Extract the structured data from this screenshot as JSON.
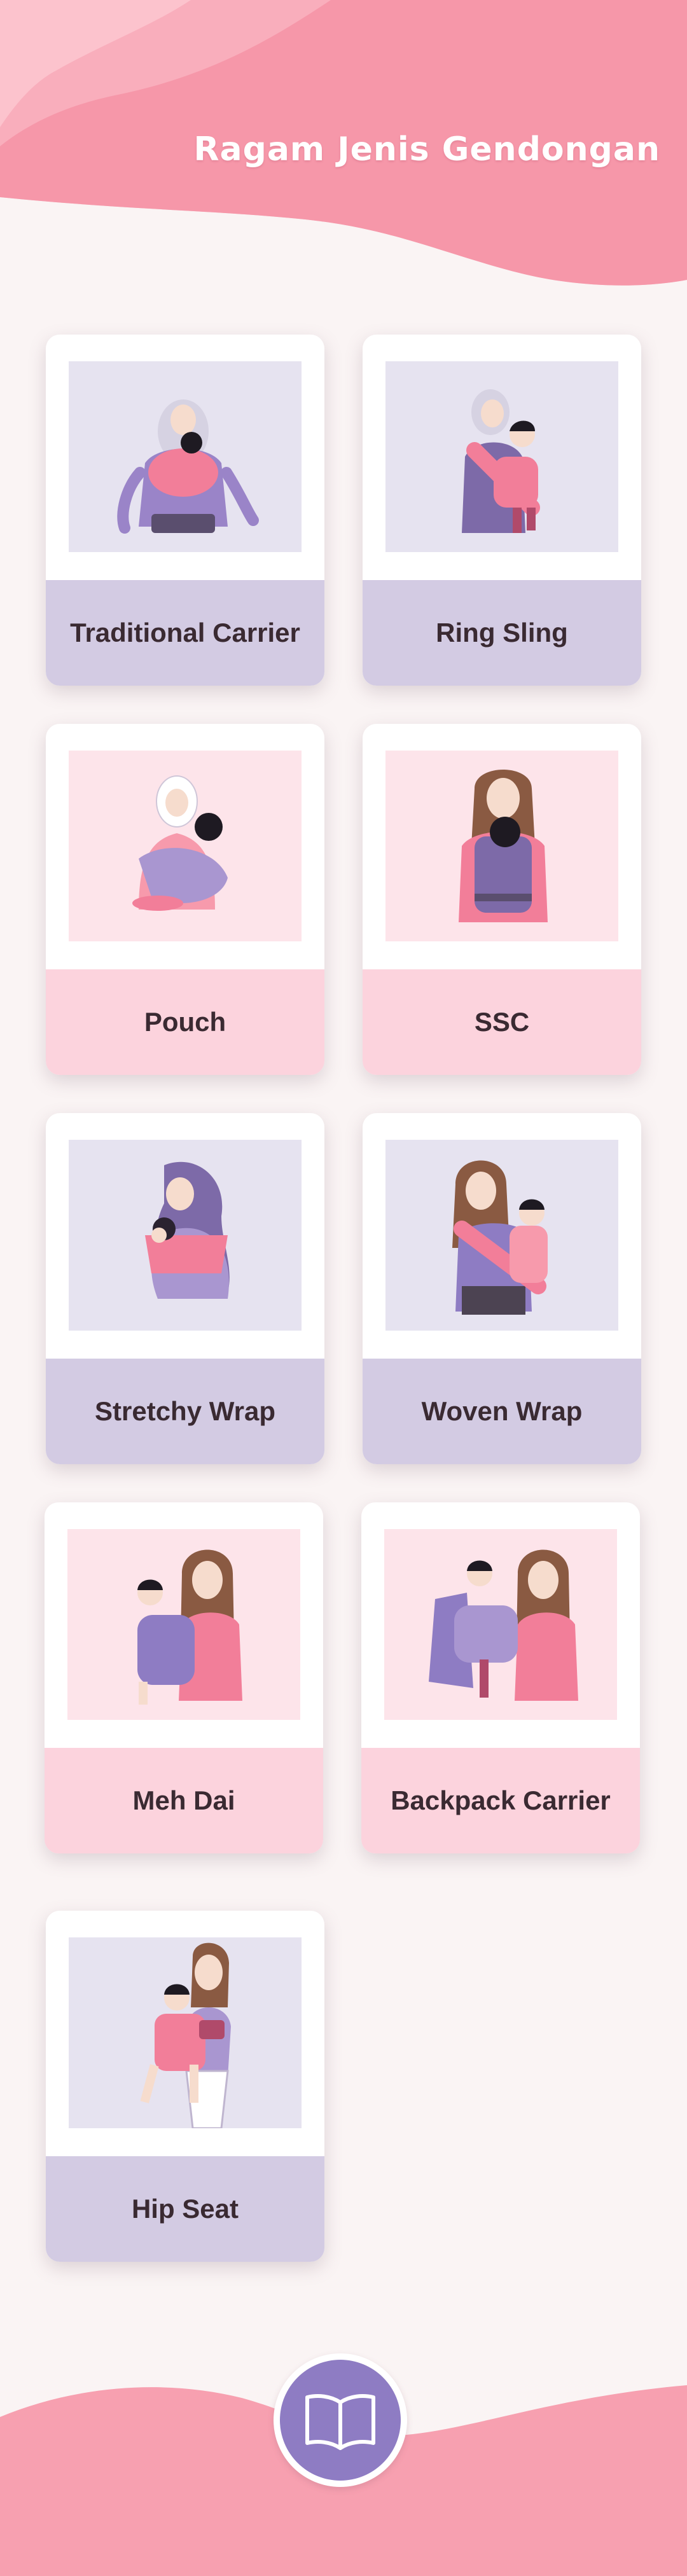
{
  "header": {
    "title": "Ragam Jenis Gendongan"
  },
  "cards": [
    {
      "label": "Traditional Carrier",
      "icon": "traditional-carrier-illustration"
    },
    {
      "label": "Ring Sling",
      "icon": "ring-sling-illustration"
    },
    {
      "label": "Pouch",
      "icon": "pouch-illustration"
    },
    {
      "label": "SSC",
      "icon": "ssc-illustration"
    },
    {
      "label": "Stretchy Wrap",
      "icon": "stretchy-wrap-illustration"
    },
    {
      "label": "Woven Wrap",
      "icon": "woven-wrap-illustration"
    },
    {
      "label": "Meh Dai",
      "icon": "meh-dai-illustration"
    },
    {
      "label": "Backpack Carrier",
      "icon": "backpack-carrier-illustration"
    },
    {
      "label": "Hip Seat",
      "icon": "hip-seat-illustration"
    }
  ],
  "footer": {
    "icon": "open-book-icon"
  },
  "colors": {
    "accent_pink": "#f79aac",
    "lavender": "#d3cbe3",
    "light_pink": "#fcd3dd",
    "purple": "#8e7cc3",
    "text_dark": "#3a2a32"
  }
}
